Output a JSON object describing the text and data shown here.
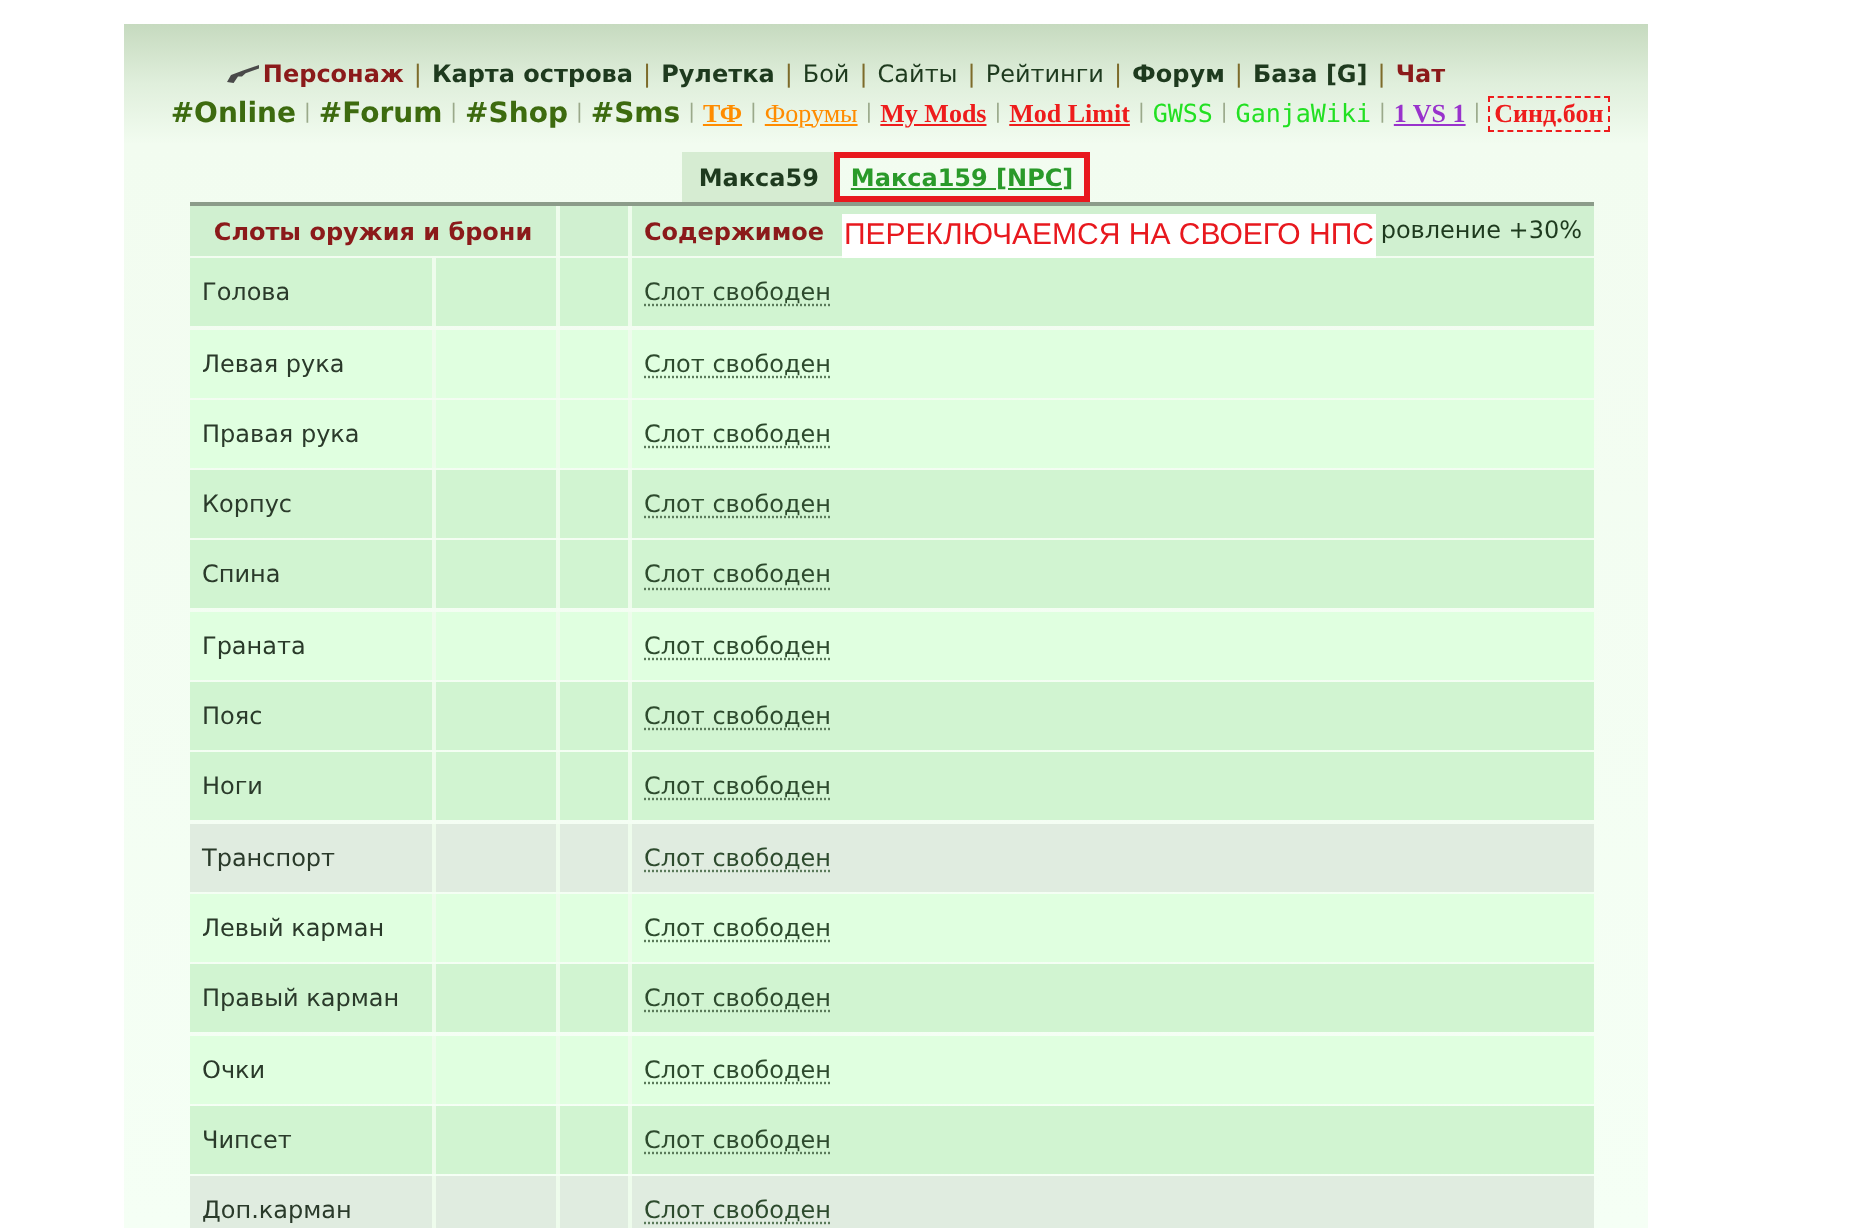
{
  "nav_primary": {
    "separator": "|",
    "items": [
      {
        "label": "Персонаж",
        "bold": true,
        "color": "#8b1a1a"
      },
      {
        "label": "Карта острова",
        "bold": true,
        "color": "#1e3a1e"
      },
      {
        "label": "Рулетка",
        "bold": true,
        "color": "#1e3a1e"
      },
      {
        "label": "Бой",
        "bold": false,
        "color": "#1e3a1e"
      },
      {
        "label": "Сайты",
        "bold": false,
        "color": "#1e3a1e"
      },
      {
        "label": "Рейтинги",
        "bold": false,
        "color": "#1e3a1e"
      },
      {
        "label": "Форум",
        "bold": true,
        "color": "#1e3a1e"
      },
      {
        "label": "База [G]",
        "bold": true,
        "color": "#1e3a1e"
      },
      {
        "label": "Чат",
        "bold": true,
        "color": "#8b1a1a"
      }
    ]
  },
  "nav_secondary": {
    "separator": "|",
    "items": [
      {
        "label": "#Online",
        "kind": "hashtag",
        "bold": true,
        "color": "#3d6b0f"
      },
      {
        "label": "#Forum",
        "kind": "hashtag",
        "bold": true,
        "color": "#3d6b0f"
      },
      {
        "label": "#Shop",
        "kind": "hashtag",
        "bold": true,
        "color": "#3d6b0f"
      },
      {
        "label": "#Sms",
        "kind": "hashtag",
        "bold": true,
        "color": "#3d6b0f"
      },
      {
        "label": "ТФ",
        "kind": "serif",
        "bold": true,
        "color": "#ff8c00"
      },
      {
        "label": "Форумы",
        "kind": "serif",
        "bold": false,
        "color": "#ff8c00"
      },
      {
        "label": "My Mods",
        "kind": "serif",
        "bold": true,
        "color": "#ee1c1c"
      },
      {
        "label": "Mod Limit",
        "kind": "serif",
        "bold": true,
        "color": "#ee1c1c"
      },
      {
        "label": "GWSS",
        "kind": "mono",
        "bold": false,
        "color": "#22e022"
      },
      {
        "label": "GanjaWiki",
        "kind": "mono",
        "bold": false,
        "color": "#22e022"
      },
      {
        "label": "1 VS 1",
        "kind": "serif",
        "bold": true,
        "color": "#9933cc"
      },
      {
        "label": "Синд.бон",
        "kind": "framed",
        "bold": true,
        "color": "#ee1c1c"
      }
    ]
  },
  "tabs": [
    {
      "label": "Макса59",
      "selected": true,
      "marked": false
    },
    {
      "label": "Макса159 [NPC]",
      "selected": false,
      "marked": true
    }
  ],
  "annotation": {
    "text": "ПЕРЕКЛЮЧАЕМСЯ НА СВОЕГО НПС"
  },
  "table": {
    "header": {
      "slot": "Слоты оружия и брони",
      "content": "Содержимое",
      "column_5": "ровление +30%"
    },
    "rows": [
      {
        "slot": "Голова",
        "content": "Слот свободен",
        "shaded": true,
        "muted": false
      },
      {
        "slot": "Левая рука",
        "content": "Слот свободен",
        "shaded": false,
        "muted": false
      },
      {
        "slot": "Правая рука",
        "content": "Слот свободен",
        "shaded": false,
        "muted": false
      },
      {
        "slot": "Корпус",
        "content": "Слот свободен",
        "shaded": true,
        "muted": false
      },
      {
        "slot": "Спина",
        "content": "Слот свободен",
        "shaded": true,
        "muted": false
      },
      {
        "slot": "Граната",
        "content": "Слот свободен",
        "shaded": false,
        "muted": false
      },
      {
        "slot": "Пояс",
        "content": "Слот свободен",
        "shaded": true,
        "muted": false
      },
      {
        "slot": "Ноги",
        "content": "Слот свободен",
        "shaded": true,
        "muted": false
      },
      {
        "slot": "Транспорт",
        "content": "Слот свободен",
        "shaded": false,
        "muted": true
      },
      {
        "slot": "Левый карман",
        "content": "Слот свободен",
        "shaded": false,
        "muted": false
      },
      {
        "slot": "Правый карман",
        "content": "Слот свободен",
        "shaded": true,
        "muted": false
      },
      {
        "slot": "Очки",
        "content": "Слот свободен",
        "shaded": false,
        "muted": false
      },
      {
        "slot": "Чипсет",
        "content": "Слот свободен",
        "shaded": true,
        "muted": false
      },
      {
        "slot": "Доп.карман",
        "content": "Слот свободен",
        "shaded": false,
        "muted": true
      }
    ]
  }
}
